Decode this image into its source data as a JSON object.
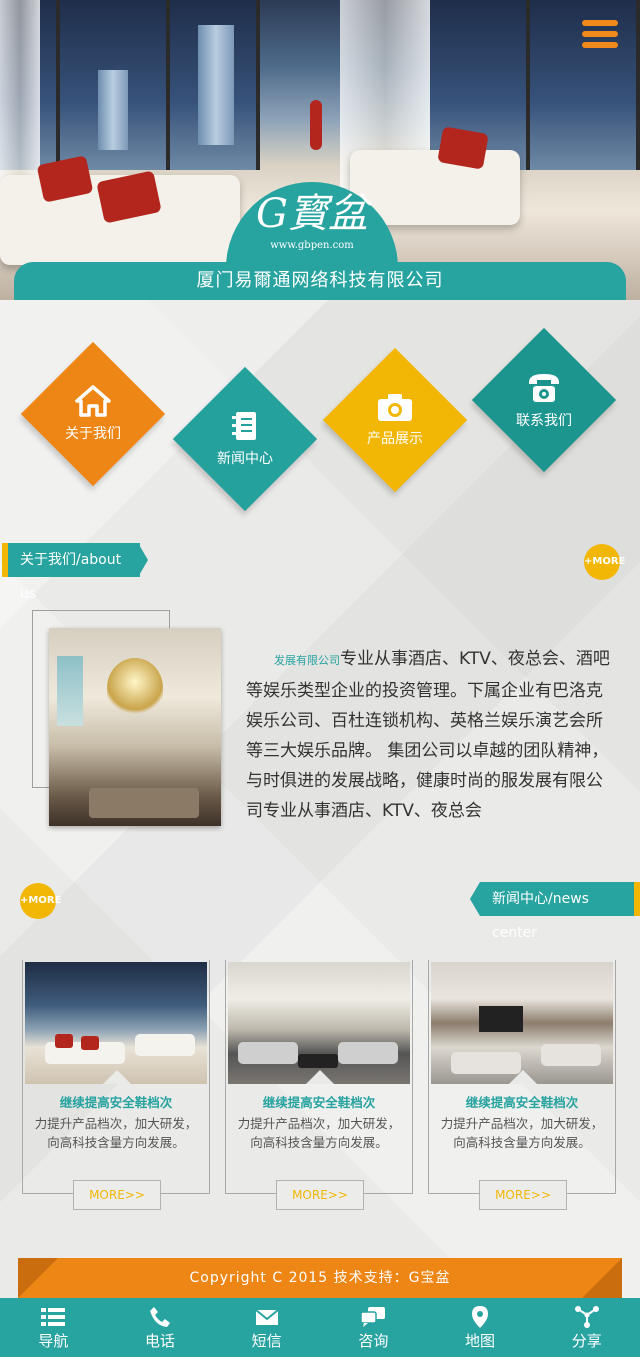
{
  "header": {
    "logo_text": "G寳盆",
    "logo_url": "www.gbpen.com",
    "company_name": "厦门易爾通网络科技有限公司",
    "menu_icon": "hamburger-menu-icon"
  },
  "quick_links": [
    {
      "label": "关于我们",
      "icon": "home-icon",
      "color": "#ee8616"
    },
    {
      "label": "新闻中心",
      "icon": "notebook-icon",
      "color": "#24a19d"
    },
    {
      "label": "产品展示",
      "icon": "camera-icon",
      "color": "#f2b705"
    },
    {
      "label": "联系我们",
      "icon": "telephone-icon",
      "color": "#1d958f"
    }
  ],
  "about": {
    "tab_label": "关于我们/about us",
    "more_label": "+MORE",
    "highlight": "发展有限公司",
    "text": "专业从事酒店、KTV、夜总会、酒吧等娱乐类型企业的投资管理。下属企业有巴洛克娱乐公司、百杜连锁机构、英格兰娱乐演艺会所等三大娱乐品牌。 集团公司以卓越的团队精神，与时俱进的发展战略，健康时尚的服发展有限公司专业从事酒店、KTV、夜总会"
  },
  "news": {
    "tab_label": "新闻中心/news center",
    "more_label": "+MORE",
    "items": [
      {
        "title": "继续提高安全鞋档次",
        "desc": "力提升产品档次，加大研发，向高科技含量方向发展。",
        "button": "MORE>>"
      },
      {
        "title": "继续提高安全鞋档次",
        "desc": "力提升产品档次，加大研发，向高科技含量方向发展。",
        "button": "MORE>>"
      },
      {
        "title": "继续提高安全鞋档次",
        "desc": "力提升产品档次，加大研发，向高科技含量方向发展。",
        "button": "MORE>>"
      }
    ]
  },
  "footer": {
    "copyright": "Copyright C 2015 技术支持：G宝盆"
  },
  "bottom_nav": [
    {
      "label": "导航",
      "icon": "list-icon"
    },
    {
      "label": "电话",
      "icon": "phone-icon"
    },
    {
      "label": "短信",
      "icon": "envelope-icon"
    },
    {
      "label": "咨询",
      "icon": "chat-bubbles-icon"
    },
    {
      "label": "地图",
      "icon": "map-pin-icon"
    },
    {
      "label": "分享",
      "icon": "share-icon"
    }
  ],
  "colors": {
    "teal": "#27a3a0",
    "orange": "#ee8616",
    "yellow": "#f2b705"
  }
}
